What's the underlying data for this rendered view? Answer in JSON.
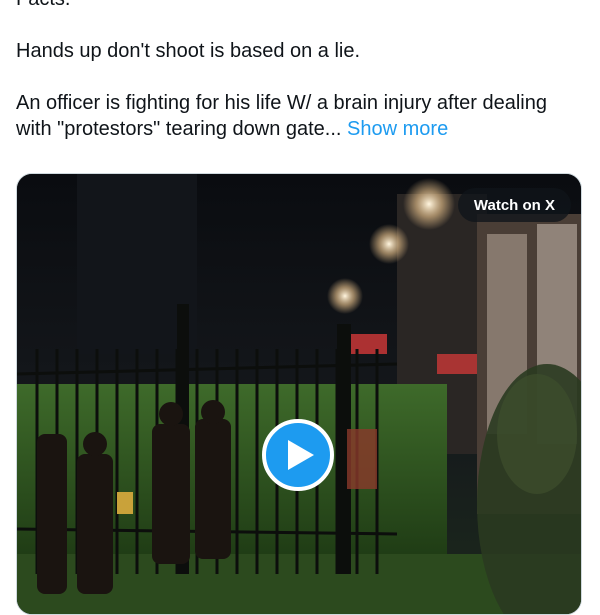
{
  "tweet": {
    "cut_line": "Facts.",
    "line_hands_up": "Hands up don't shoot is based on a lie.",
    "line_officer": "An officer is fighting for his life W/ a brain injury after dealing with \"protestors\" tearing down gate...",
    "show_more": "Show more"
  },
  "media": {
    "watch_badge": "Watch on X",
    "play_icon": "play-icon"
  },
  "colors": {
    "link": "#1d9bf0",
    "play_button": "#1d9bf0",
    "badge_bg": "#0f1419",
    "text": "#0f1419"
  }
}
